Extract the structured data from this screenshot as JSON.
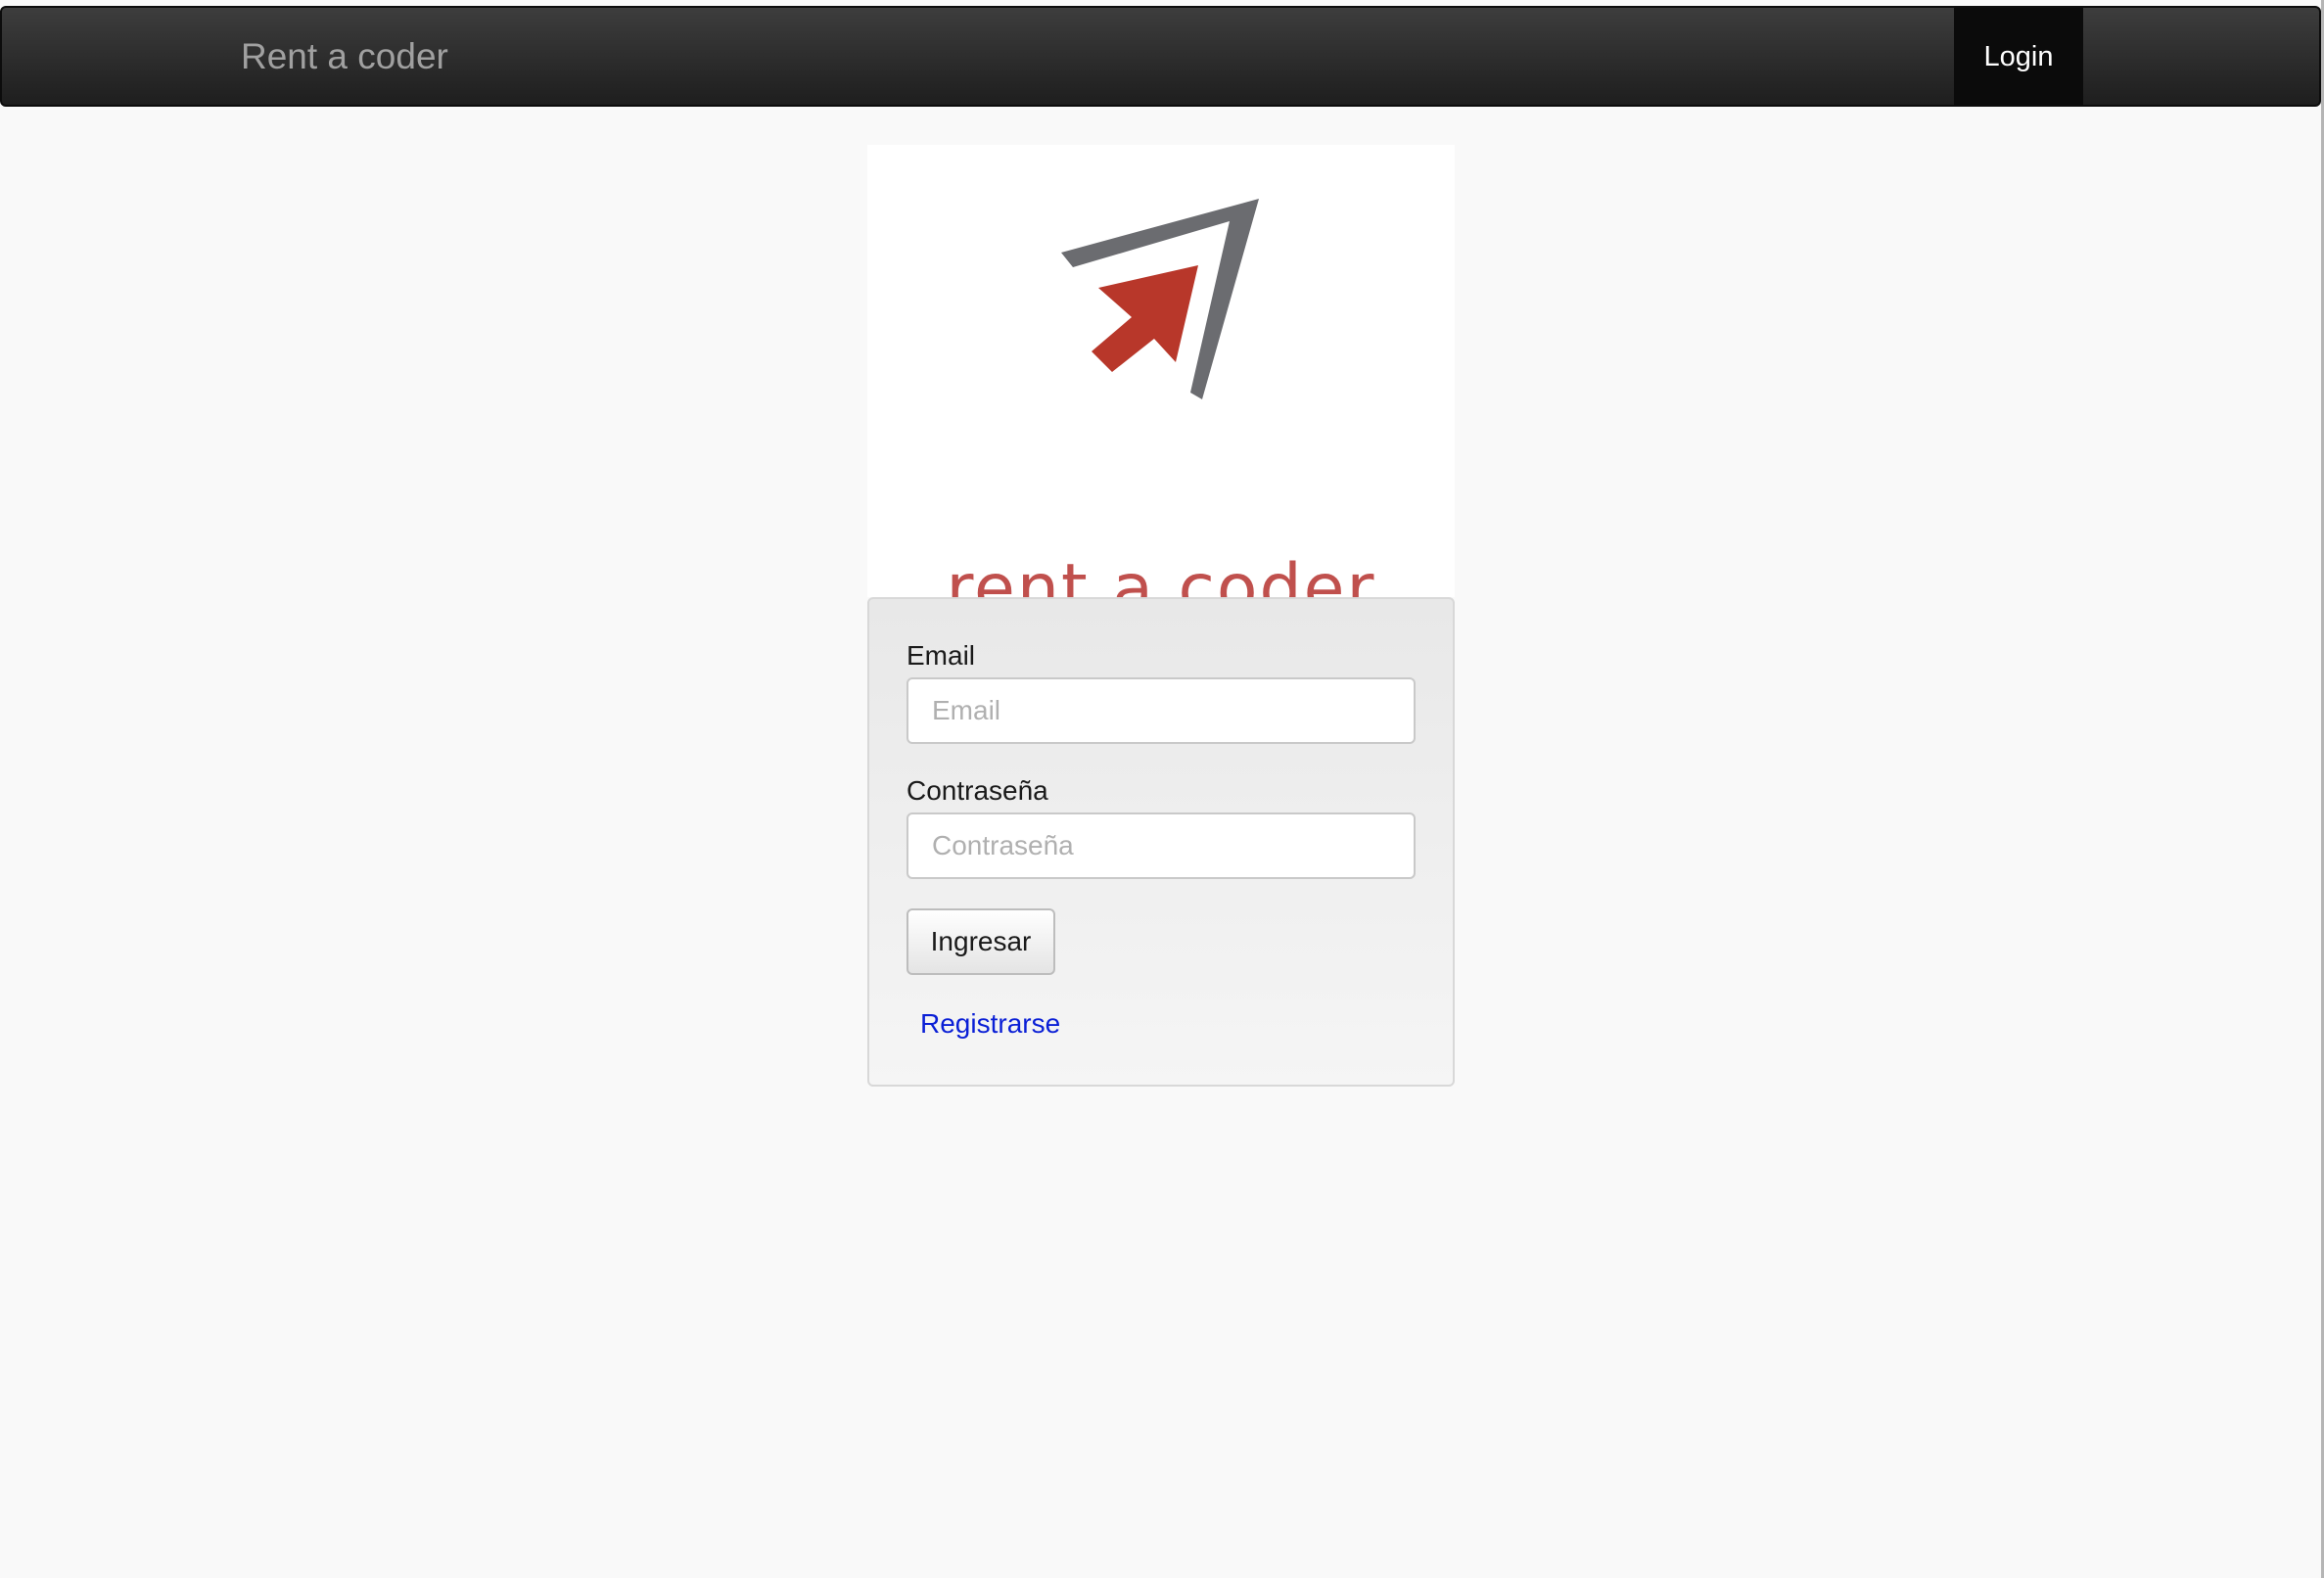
{
  "navbar": {
    "brand": "Rent a coder",
    "login_label": "Login"
  },
  "logo": {
    "text": "rent a coder",
    "colors": {
      "chevron": "#6b6c70",
      "arrow": "#b8372a",
      "text": "#c0504d"
    }
  },
  "login_form": {
    "email_label": "Email",
    "email_placeholder": "Email",
    "email_value": "",
    "password_label": "Contraseña",
    "password_placeholder": "Contraseña",
    "password_value": "",
    "submit_label": "Ingresar",
    "register_link": "Registrarse"
  },
  "colors": {
    "navbar_bg": "#2b2b2b",
    "nav_active_bg": "#0b0b0b",
    "page_bg": "#f9f9f9",
    "link": "#0a1fd6"
  }
}
